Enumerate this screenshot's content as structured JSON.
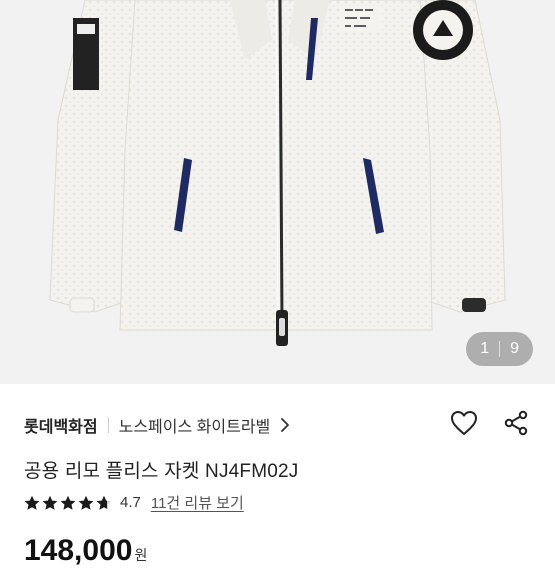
{
  "gallery": {
    "current": "1",
    "total": "9",
    "image_label": "흰색 플리스 자켓 사진",
    "brand_patch": "THE NORTH FACE"
  },
  "product": {
    "store": "롯데백화점",
    "brand": "노스페이스 화이트라벨",
    "title": "공용 리모 플리스 자켓 NJ4FM02J",
    "rating": "4.7",
    "rating_fraction": 0.94,
    "reviews_link": "11건 리뷰 보기",
    "price": "148,000",
    "price_unit": "원"
  },
  "icons": {
    "favorite": "heart-icon",
    "share": "share-icon",
    "brand_chevron": "chevron-right-icon",
    "star": "star-icon"
  },
  "colors": {
    "accent_navy": "#1f2a63",
    "star": "#1a1a1a",
    "text": "#222222"
  }
}
